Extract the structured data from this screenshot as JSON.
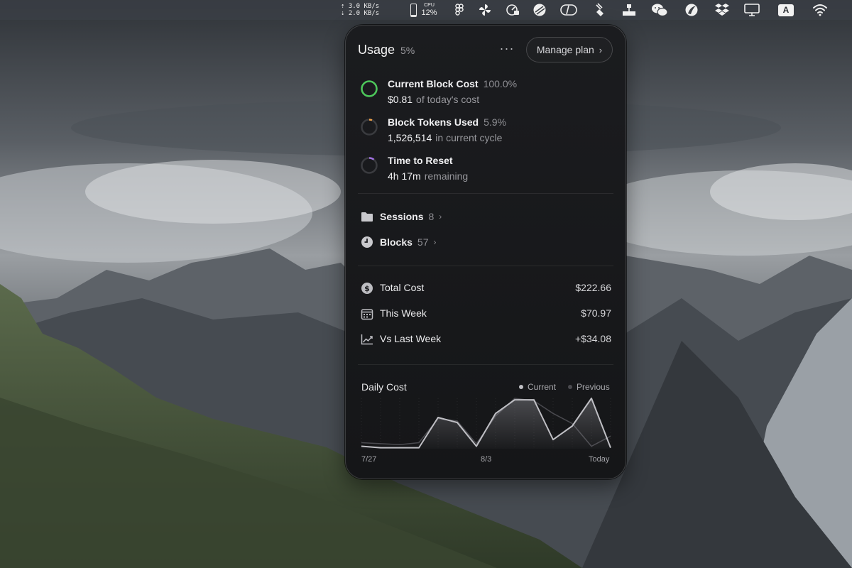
{
  "menubar": {
    "net_up": "3.0 KB/s",
    "net_down": "2.0 KB/s",
    "cpu_label": "CPU",
    "cpu_value": "12%",
    "input_badge": "A"
  },
  "panel": {
    "title": "Usage",
    "title_pct": "5%",
    "more_label": "···",
    "manage_label": "Manage plan",
    "stats": [
      {
        "title": "Current Block Cost",
        "pct": "100.0%",
        "value": "$0.81",
        "suffix": "of today's cost",
        "ring_color": "#4cc85a",
        "progress": 1.0
      },
      {
        "title": "Block Tokens Used",
        "pct": "5.9%",
        "value": "1,526,514",
        "suffix": "in current cycle",
        "ring_color": "#f0a24a",
        "progress": 0.059
      },
      {
        "title": "Time to Reset",
        "value": "4h 17m",
        "suffix": "remaining",
        "ring_color": "#a070e0",
        "progress": 0.1
      }
    ],
    "nav": [
      {
        "label": "Sessions",
        "count": "8"
      },
      {
        "label": "Blocks",
        "count": "57"
      }
    ],
    "finance": [
      {
        "label": "Total Cost",
        "value": "$222.66",
        "icon": "dollar-icon"
      },
      {
        "label": "This Week",
        "value": "$70.97",
        "icon": "calendar-icon"
      },
      {
        "label": "Vs Last Week",
        "value": "+$34.08",
        "icon": "trend-icon"
      }
    ]
  },
  "chart_data": {
    "type": "area",
    "title": "Daily Cost",
    "legend": [
      "Current",
      "Previous"
    ],
    "legend_placement": "top-right",
    "x_tick_labels": [
      "7/27",
      "8/3",
      "Today"
    ],
    "series": [
      {
        "name": "Current",
        "values": [
          0.05,
          0.02,
          0.02,
          0.02,
          0.62,
          0.52,
          0.05,
          0.7,
          0.97,
          0.97,
          0.18,
          0.45,
          1.0,
          0.02
        ]
      },
      {
        "name": "Previous",
        "values": [
          0.12,
          0.1,
          0.08,
          0.12,
          0.6,
          0.55,
          0.1,
          0.65,
          1.0,
          0.95,
          0.7,
          0.5,
          0.05,
          0.25
        ]
      }
    ],
    "ylim": [
      0,
      1
    ],
    "colors": {
      "current": "#bfbfc4",
      "previous": "#4a4a4f"
    }
  }
}
